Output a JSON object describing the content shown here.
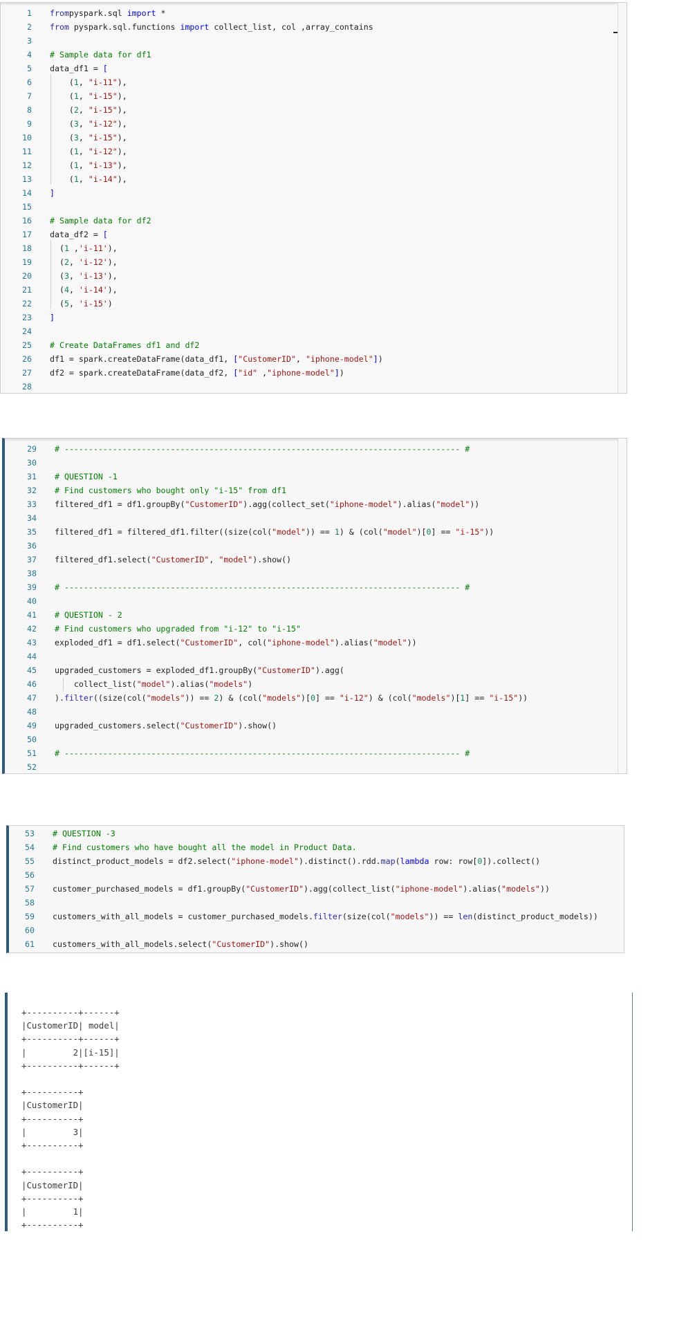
{
  "cell1": {
    "lines": [
      {
        "n": "1",
        "t": [
          [
            "kw2",
            "from"
          ],
          [
            "",
            "pyspark.sql "
          ],
          [
            "kw",
            "import"
          ],
          [
            "",
            " *"
          ]
        ]
      },
      {
        "n": "2",
        "t": [
          [
            "kw2",
            "from"
          ],
          [
            "",
            " pyspark.sql.functions "
          ],
          [
            "kw",
            "import"
          ],
          [
            "",
            " collect_list, col ,array_contains"
          ]
        ]
      },
      {
        "n": "3",
        "t": []
      },
      {
        "n": "4",
        "t": [
          [
            "cmt",
            "# Sample data for df1"
          ]
        ]
      },
      {
        "n": "5",
        "t": [
          [
            "",
            "data_df1 = "
          ],
          [
            "kw",
            "["
          ]
        ]
      },
      {
        "n": "6",
        "t": [
          [
            "",
            "    ("
          ],
          [
            "num",
            "1"
          ],
          [
            "",
            ", "
          ],
          [
            "str",
            "\"i-11\""
          ],
          [
            "",
            "),"
          ]
        ]
      },
      {
        "n": "7",
        "t": [
          [
            "",
            "    ("
          ],
          [
            "num",
            "1"
          ],
          [
            "",
            ", "
          ],
          [
            "str",
            "\"i-15\""
          ],
          [
            "",
            "),"
          ]
        ]
      },
      {
        "n": "8",
        "t": [
          [
            "",
            "    ("
          ],
          [
            "num",
            "2"
          ],
          [
            "",
            ", "
          ],
          [
            "str",
            "\"i-15\""
          ],
          [
            "",
            "),"
          ]
        ]
      },
      {
        "n": "9",
        "t": [
          [
            "",
            "    ("
          ],
          [
            "num",
            "3"
          ],
          [
            "",
            ", "
          ],
          [
            "str",
            "\"i-12\""
          ],
          [
            "",
            "),"
          ]
        ]
      },
      {
        "n": "10",
        "t": [
          [
            "",
            "    ("
          ],
          [
            "num",
            "3"
          ],
          [
            "",
            ", "
          ],
          [
            "str",
            "\"i-15\""
          ],
          [
            "",
            "),"
          ]
        ]
      },
      {
        "n": "11",
        "t": [
          [
            "",
            "    ("
          ],
          [
            "num",
            "1"
          ],
          [
            "",
            ", "
          ],
          [
            "str",
            "\"i-12\""
          ],
          [
            "",
            "),"
          ]
        ]
      },
      {
        "n": "12",
        "t": [
          [
            "",
            "    ("
          ],
          [
            "num",
            "1"
          ],
          [
            "",
            ", "
          ],
          [
            "str",
            "\"i-13\""
          ],
          [
            "",
            "),"
          ]
        ]
      },
      {
        "n": "13",
        "t": [
          [
            "",
            "    ("
          ],
          [
            "num",
            "1"
          ],
          [
            "",
            ", "
          ],
          [
            "str",
            "\"i-14\""
          ],
          [
            "",
            "),"
          ]
        ]
      },
      {
        "n": "14",
        "t": [
          [
            "kw",
            "]"
          ]
        ]
      },
      {
        "n": "15",
        "t": []
      },
      {
        "n": "16",
        "t": [
          [
            "cmt",
            "# Sample data for df2"
          ]
        ]
      },
      {
        "n": "17",
        "t": [
          [
            "",
            "data_df2 = "
          ],
          [
            "kw",
            "["
          ]
        ]
      },
      {
        "n": "18",
        "t": [
          [
            "",
            "  ("
          ],
          [
            "num",
            "1"
          ],
          [
            "",
            " ,"
          ],
          [
            "str",
            "'i-11'"
          ],
          [
            "",
            "),"
          ]
        ]
      },
      {
        "n": "19",
        "t": [
          [
            "",
            "  ("
          ],
          [
            "num",
            "2"
          ],
          [
            "",
            ", "
          ],
          [
            "str",
            "'i-12'"
          ],
          [
            "",
            "),"
          ]
        ]
      },
      {
        "n": "20",
        "t": [
          [
            "",
            "  ("
          ],
          [
            "num",
            "3"
          ],
          [
            "",
            ", "
          ],
          [
            "str",
            "'i-13'"
          ],
          [
            "",
            "),"
          ]
        ]
      },
      {
        "n": "21",
        "t": [
          [
            "",
            "  ("
          ],
          [
            "num",
            "4"
          ],
          [
            "",
            ", "
          ],
          [
            "str",
            "'i-14'"
          ],
          [
            "",
            "),"
          ]
        ]
      },
      {
        "n": "22",
        "t": [
          [
            "",
            "  ("
          ],
          [
            "num",
            "5"
          ],
          [
            "",
            ", "
          ],
          [
            "str",
            "'i-15'"
          ],
          [
            "",
            ")"
          ]
        ]
      },
      {
        "n": "23",
        "t": [
          [
            "kw",
            "]"
          ]
        ]
      },
      {
        "n": "24",
        "t": []
      },
      {
        "n": "25",
        "t": [
          [
            "cmt",
            "# Create DataFrames df1 and df2"
          ]
        ]
      },
      {
        "n": "26",
        "t": [
          [
            "",
            "df1 = spark.createDataFrame(data_df1, "
          ],
          [
            "kw",
            "["
          ],
          [
            "str",
            "\"CustomerID\""
          ],
          [
            "",
            ", "
          ],
          [
            "str",
            "\"iphone-model\""
          ],
          [
            "kw",
            "]"
          ],
          [
            "",
            ")"
          ]
        ]
      },
      {
        "n": "27",
        "t": [
          [
            "",
            "df2 = spark.createDataFrame(data_df2, "
          ],
          [
            "kw",
            "["
          ],
          [
            "str",
            "\"id\""
          ],
          [
            "",
            " ,"
          ],
          [
            "str",
            "\"iphone-model\""
          ],
          [
            "kw",
            "]"
          ],
          [
            "",
            ")"
          ]
        ]
      },
      {
        "n": "28",
        "t": []
      }
    ]
  },
  "cell2": {
    "lines": [
      {
        "n": "29",
        "t": [
          [
            "cmt",
            "# ---------------------------------------------------------------------------------- #"
          ]
        ]
      },
      {
        "n": "30",
        "t": []
      },
      {
        "n": "31",
        "t": [
          [
            "cmt",
            "# QUESTION -1"
          ]
        ]
      },
      {
        "n": "32",
        "t": [
          [
            "cmt",
            "# Find customers who bought only \"i-15\" from df1"
          ]
        ]
      },
      {
        "n": "33",
        "t": [
          [
            "",
            "filtered_df1 = df1.groupBy("
          ],
          [
            "str",
            "\"CustomerID\""
          ],
          [
            "",
            ").agg(collect_set("
          ],
          [
            "str",
            "\"iphone-model\""
          ],
          [
            "",
            ").alias("
          ],
          [
            "str",
            "\"model\""
          ],
          [
            "",
            "))"
          ]
        ]
      },
      {
        "n": "34",
        "t": []
      },
      {
        "n": "35",
        "t": [
          [
            "",
            "filtered_df1 = filtered_df1.filter((size(col("
          ],
          [
            "str",
            "\"model\""
          ],
          [
            "",
            ")) == "
          ],
          [
            "num",
            "1"
          ],
          [
            "",
            ") & (col("
          ],
          [
            "str",
            "\"model\""
          ],
          [
            "",
            ")["
          ],
          [
            "num",
            "0"
          ],
          [
            "",
            "] == "
          ],
          [
            "str",
            "\"i-15\""
          ],
          [
            "",
            "))"
          ]
        ]
      },
      {
        "n": "36",
        "t": []
      },
      {
        "n": "37",
        "t": [
          [
            "",
            "filtered_df1.select("
          ],
          [
            "str",
            "\"CustomerID\""
          ],
          [
            "",
            ", "
          ],
          [
            "str",
            "\"model\""
          ],
          [
            "",
            ").show()"
          ]
        ]
      },
      {
        "n": "38",
        "t": []
      },
      {
        "n": "39",
        "t": [
          [
            "cmt",
            "# ---------------------------------------------------------------------------------- #"
          ]
        ]
      },
      {
        "n": "40",
        "t": []
      },
      {
        "n": "41",
        "t": [
          [
            "cmt",
            "# QUESTION - 2"
          ]
        ]
      },
      {
        "n": "42",
        "t": [
          [
            "cmt",
            "# Find customers who upgraded from \"i-12\" to \"i-15\""
          ]
        ]
      },
      {
        "n": "43",
        "t": [
          [
            "",
            "exploded_df1 = df1.select("
          ],
          [
            "str",
            "\"CustomerID\""
          ],
          [
            "",
            ", col("
          ],
          [
            "str",
            "\"iphone-model\""
          ],
          [
            "",
            ").alias("
          ],
          [
            "str",
            "\"model\""
          ],
          [
            "",
            "))"
          ]
        ]
      },
      {
        "n": "44",
        "t": []
      },
      {
        "n": "45",
        "t": [
          [
            "",
            "upgraded_customers = exploded_df1.groupBy("
          ],
          [
            "str",
            "\"CustomerID\""
          ],
          [
            "",
            ").agg("
          ]
        ]
      },
      {
        "n": "46",
        "t": [
          [
            "",
            "    collect_list("
          ],
          [
            "str",
            "\"model\""
          ],
          [
            "",
            ").alias("
          ],
          [
            "str",
            "\"models\""
          ],
          [
            "",
            ")"
          ]
        ]
      },
      {
        "n": "47",
        "t": [
          [
            "",
            ")."
          ],
          [
            "kw2",
            "filter"
          ],
          [
            "",
            "((size(col("
          ],
          [
            "str",
            "\"models\""
          ],
          [
            "",
            ")) == "
          ],
          [
            "num",
            "2"
          ],
          [
            "",
            ") & (col("
          ],
          [
            "str",
            "\"models\""
          ],
          [
            "",
            ")["
          ],
          [
            "num",
            "0"
          ],
          [
            "",
            "] == "
          ],
          [
            "str",
            "\"i-12\""
          ],
          [
            "",
            ") & (col("
          ],
          [
            "str",
            "\"models\""
          ],
          [
            "",
            ")["
          ],
          [
            "num",
            "1"
          ],
          [
            "",
            "] == "
          ],
          [
            "str",
            "\"i-15\""
          ],
          [
            "",
            "))"
          ]
        ]
      },
      {
        "n": "48",
        "t": []
      },
      {
        "n": "49",
        "t": [
          [
            "",
            "upgraded_customers.select("
          ],
          [
            "str",
            "\"CustomerID\""
          ],
          [
            "",
            ").show()"
          ]
        ]
      },
      {
        "n": "50",
        "t": []
      },
      {
        "n": "51",
        "t": [
          [
            "cmt",
            "# ---------------------------------------------------------------------------------- #"
          ]
        ]
      },
      {
        "n": "52",
        "t": []
      }
    ]
  },
  "cell3": {
    "lines": [
      {
        "n": "53",
        "t": [
          [
            "cmt",
            "# QUESTION -3"
          ]
        ]
      },
      {
        "n": "54",
        "t": [
          [
            "cmt",
            "# Find customers who have bought all the model in Product Data."
          ]
        ]
      },
      {
        "n": "55",
        "t": [
          [
            "",
            "distinct_product_models = df2.select("
          ],
          [
            "str",
            "\"iphone-model\""
          ],
          [
            "",
            ").distinct().rdd."
          ],
          [
            "kw2",
            "map"
          ],
          [
            "",
            "("
          ],
          [
            "kw",
            "lambda"
          ],
          [
            "",
            " row: row["
          ],
          [
            "num",
            "0"
          ],
          [
            "",
            "]).collect()"
          ]
        ]
      },
      {
        "n": "56",
        "t": []
      },
      {
        "n": "57",
        "t": [
          [
            "",
            "customer_purchased_models = df1.groupBy("
          ],
          [
            "str",
            "\"CustomerID\""
          ],
          [
            "",
            ").agg(collect_list("
          ],
          [
            "str",
            "\"iphone-model\""
          ],
          [
            "",
            ").alias("
          ],
          [
            "str",
            "\"models\""
          ],
          [
            "",
            "))"
          ]
        ]
      },
      {
        "n": "58",
        "t": []
      },
      {
        "n": "59",
        "t": [
          [
            "",
            "customers_with_all_models = customer_purchased_models."
          ],
          [
            "kw2",
            "filter"
          ],
          [
            "",
            "(size(col("
          ],
          [
            "str",
            "\"models\""
          ],
          [
            "",
            ")) == "
          ],
          [
            "kw2",
            "len"
          ],
          [
            "",
            "(distinct_product_models))"
          ]
        ]
      },
      {
        "n": "60",
        "t": []
      },
      {
        "n": "61",
        "t": [
          [
            "",
            "customers_with_all_models.select("
          ],
          [
            "str",
            "\"CustomerID\""
          ],
          [
            "",
            ").show()"
          ]
        ]
      }
    ]
  },
  "output": {
    "lines": [
      "+----------+------+",
      "|CustomerID| model|",
      "+----------+------+",
      "|         2|[i-15]|",
      "+----------+------+",
      "",
      "+----------+",
      "|CustomerID|",
      "+----------+",
      "|         3|",
      "+----------+",
      "",
      "+----------+",
      "|CustomerID|",
      "+----------+",
      "|         1|",
      "+----------+"
    ]
  }
}
